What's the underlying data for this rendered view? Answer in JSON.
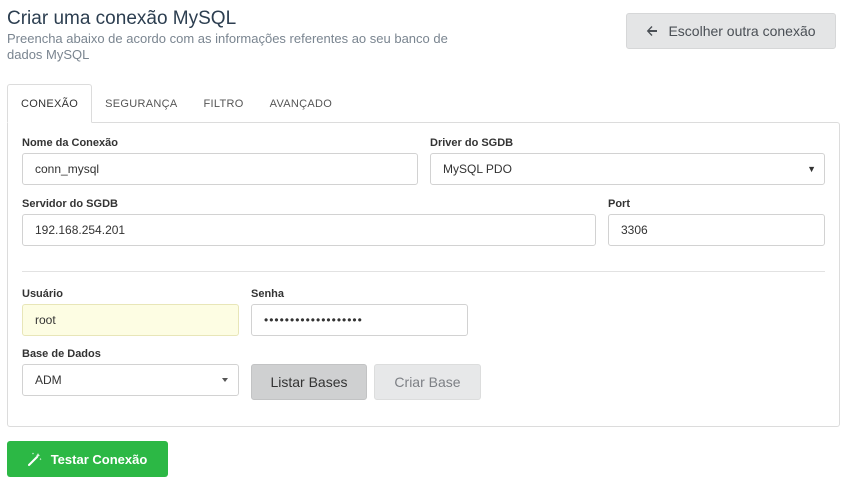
{
  "header": {
    "title": "Criar uma conexão MySQL",
    "subtitle": "Preencha abaixo de acordo com as informações referentes ao seu banco de dados MySQL",
    "choose_button": "Escolher outra conexão"
  },
  "tabs": [
    {
      "label": "CONEXÃO",
      "active": true
    },
    {
      "label": "SEGURANÇA",
      "active": false
    },
    {
      "label": "FILTRO",
      "active": false
    },
    {
      "label": "AVANÇADO",
      "active": false
    }
  ],
  "form": {
    "connection_name": {
      "label": "Nome da Conexão",
      "value": "conn_mysql"
    },
    "driver": {
      "label": "Driver do SGDB",
      "value": "MySQL PDO"
    },
    "server": {
      "label": "Servidor do SGDB",
      "value": "192.168.254.201"
    },
    "port": {
      "label": "Port",
      "value": "3306"
    },
    "user": {
      "label": "Usuário",
      "value": "root"
    },
    "password": {
      "label": "Senha",
      "value": "•••••••••••••••••••"
    },
    "database": {
      "label": "Base de Dados",
      "value": "ADM"
    },
    "list_button": "Listar Bases",
    "create_button": "Criar Base"
  },
  "test_button": "Testar Conexão",
  "colors": {
    "primary_green": "#2cb845",
    "title": "#2c3e50",
    "highlight_field": "#fdfde3"
  }
}
